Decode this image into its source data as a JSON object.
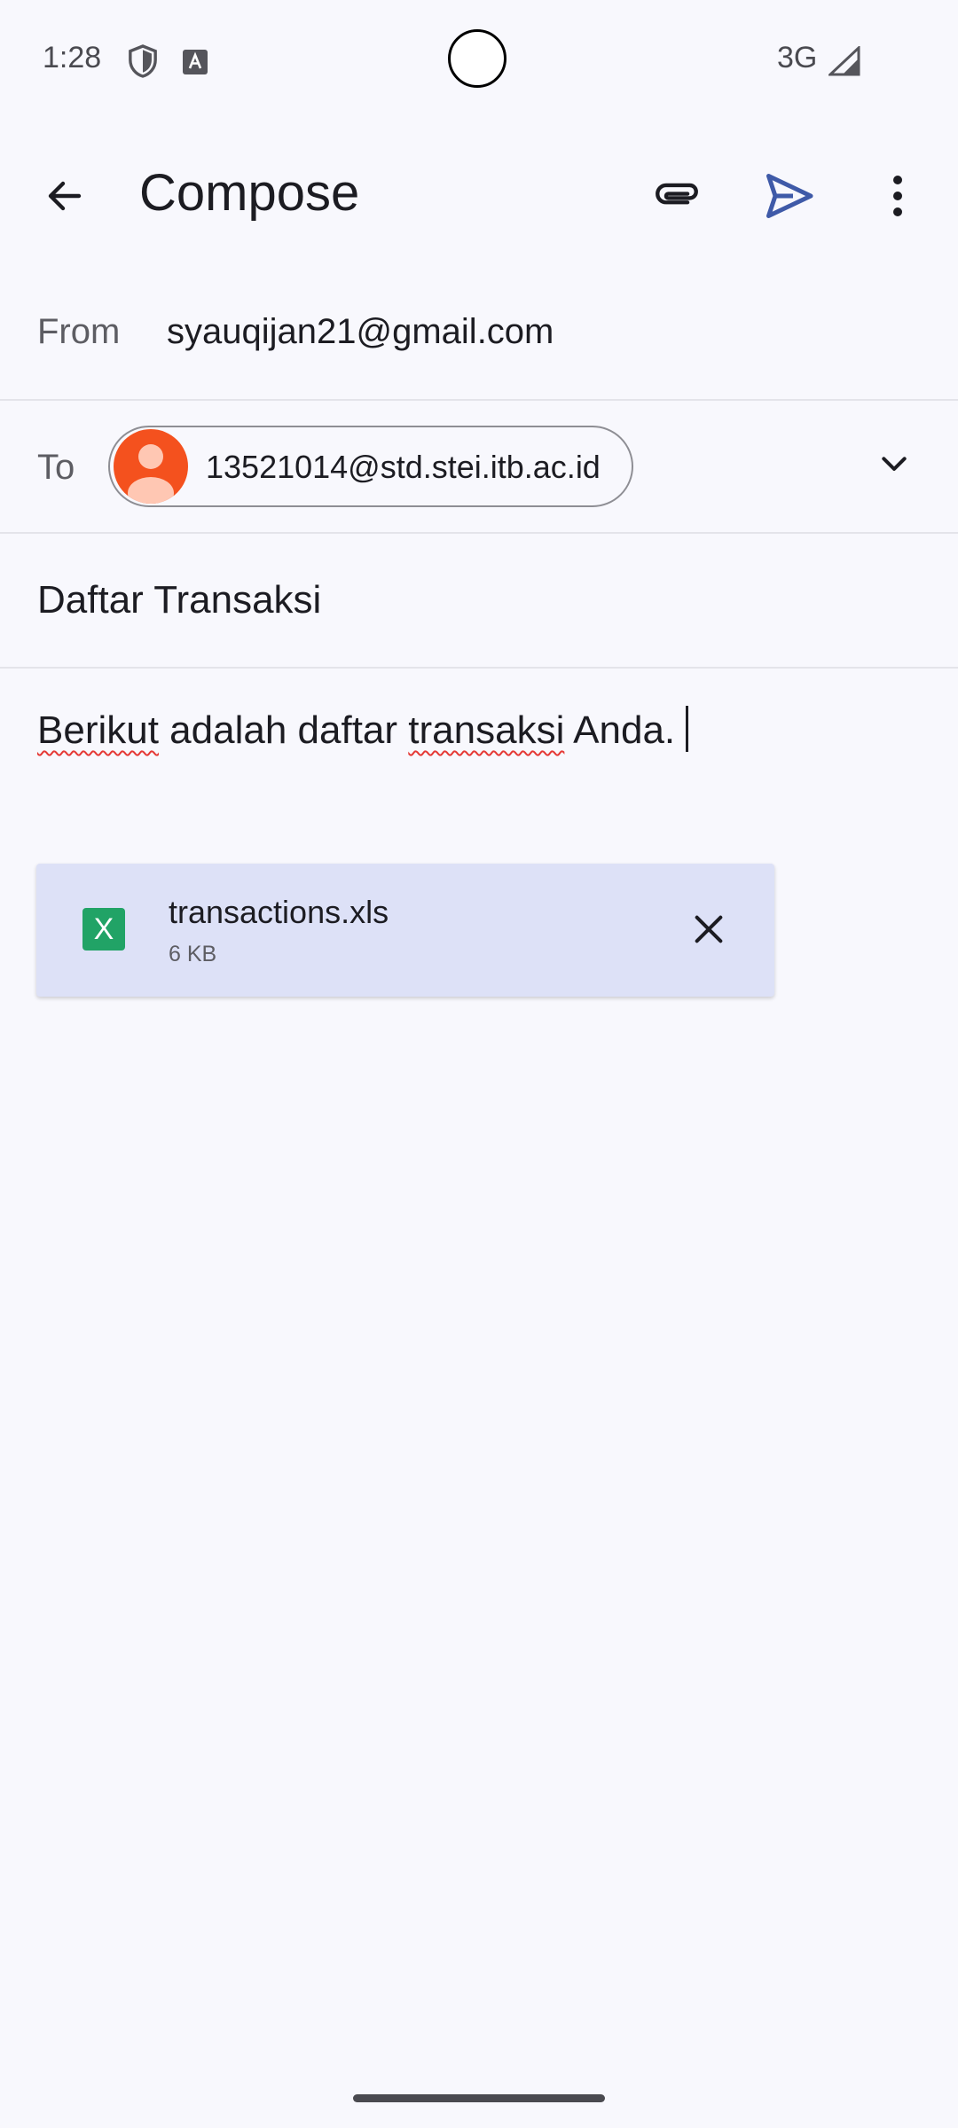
{
  "status_bar": {
    "time": "1:28",
    "network": "3G",
    "icons": [
      "shield-icon",
      "text-a-icon",
      "signal-icon"
    ]
  },
  "app_bar": {
    "title": "Compose",
    "icons": [
      "arrow-back-icon",
      "paperclip-icon",
      "send-icon",
      "more-vert-icon"
    ],
    "send_color": "#3f5aa8"
  },
  "from": {
    "label": "From",
    "value": "syauqijan21@gmail.com"
  },
  "to": {
    "label": "To",
    "recipient": "13521014@std.stei.itb.ac.id",
    "avatar_color": "#f4511e"
  },
  "subject": {
    "value": "Daftar Transaksi"
  },
  "body": {
    "word1": "Berikut",
    "mid1": " adalah daftar ",
    "word2": "transaksi",
    "mid2": " Anda."
  },
  "attachment": {
    "icon_letter": "X",
    "name": "transactions.xls",
    "size": "6 KB",
    "icon_color": "#21a366"
  }
}
